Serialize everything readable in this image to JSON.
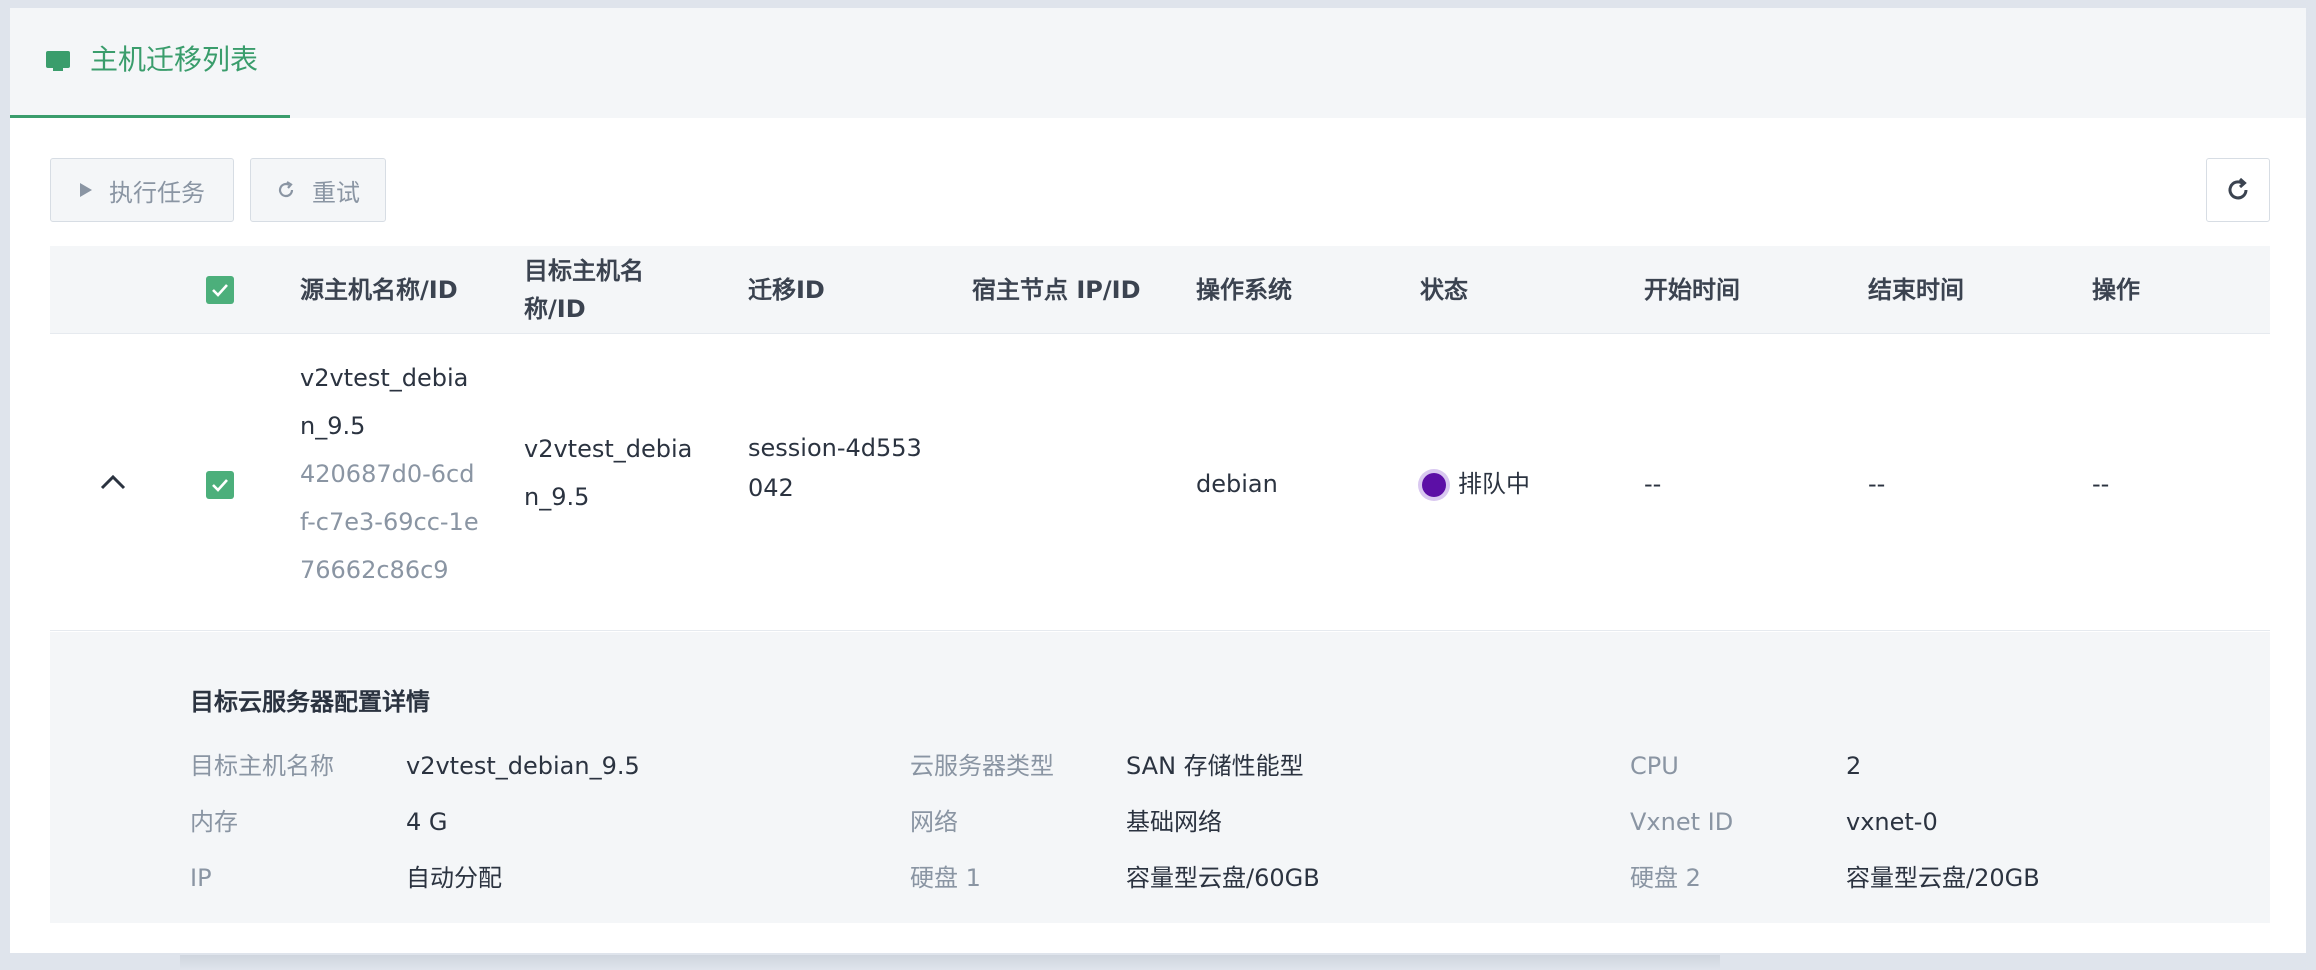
{
  "tab": {
    "icon": "monitor-icon",
    "label": "主机迁移列表"
  },
  "toolbar": {
    "run_label": "执行任务",
    "retry_label": "重试",
    "refresh_icon": "refresh-icon"
  },
  "table": {
    "headers": {
      "source": "源主机名称/ID",
      "target_line1": "目标主机名",
      "target_line2": "称/ID",
      "migration_id": "迁移ID",
      "host_node": "宿主节点 IP/ID",
      "os": "操作系统",
      "status": "状态",
      "start_time": "开始时间",
      "end_time": "结束时间",
      "actions": "操作"
    },
    "rows": [
      {
        "source_name_lines": [
          "v2vtest_debia",
          "n_9.5"
        ],
        "source_id_lines": [
          "420687d0-6cd",
          "f-c7e3-69cc-1e",
          "76662c86c9"
        ],
        "target_name_lines": [
          "v2vtest_debia",
          "n_9.5"
        ],
        "migration_id_lines": [
          "session-4d553",
          "042"
        ],
        "host_node": "",
        "os": "debian",
        "status": "排队中",
        "status_color": "#5c0fa6",
        "start_time": "--",
        "end_time": "--",
        "actions": "--"
      }
    ]
  },
  "detail": {
    "title": "目标云服务器配置详情",
    "fields": [
      {
        "label": "目标主机名称",
        "value": "v2vtest_debian_9.5"
      },
      {
        "label": "云服务器类型",
        "value": "SAN 存储性能型"
      },
      {
        "label": "CPU",
        "value": "2"
      },
      {
        "label": "内存",
        "value": "4 G"
      },
      {
        "label": "网络",
        "value": "基础网络"
      },
      {
        "label": "Vxnet ID",
        "value": "vxnet-0"
      },
      {
        "label": "IP",
        "value": "自动分配"
      },
      {
        "label": "硬盘 1",
        "value": "容量型云盘/60GB"
      },
      {
        "label": "硬盘 2",
        "value": "容量型云盘/20GB"
      }
    ]
  },
  "colors": {
    "accent": "#3a9d6c",
    "checkbox": "#4caf7b",
    "status_queued": "#5c0fa6"
  }
}
